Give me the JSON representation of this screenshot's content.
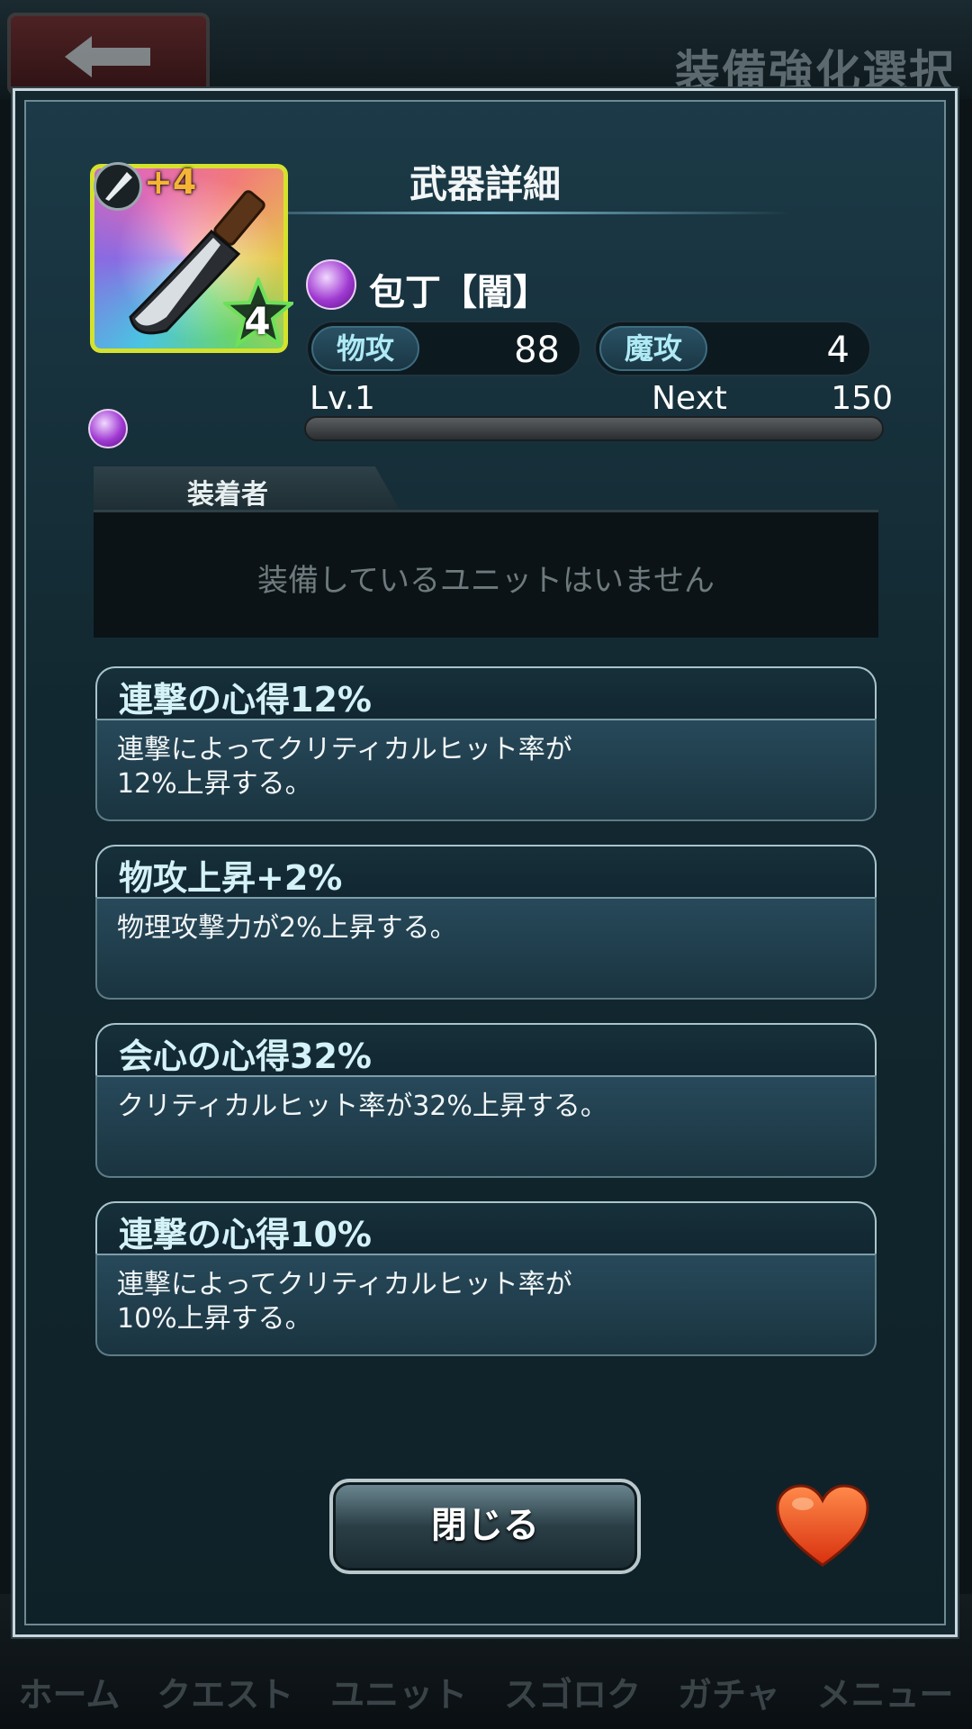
{
  "background": {
    "screen_title": "装備強化選択",
    "nav_items": [
      "ホーム",
      "クエスト",
      "ユニット",
      "スゴロク",
      "ガチャ",
      "メニュー"
    ]
  },
  "modal": {
    "title": "武器詳細",
    "weapon": {
      "name": "包丁【闇】",
      "plus": "+4",
      "rarity": "4",
      "element_icon": "dark-element-icon",
      "type_icon": "knife-type-icon",
      "stats": {
        "phys_label": "物攻",
        "phys_value": "88",
        "mag_label": "魔攻",
        "mag_value": "4"
      },
      "level": "Lv.1",
      "next_label": "Next",
      "next_value": "150",
      "exp_progress": 0.0
    },
    "equipped": {
      "tab_label": "装着者",
      "empty_text": "装備しているユニットはいません"
    },
    "skills": [
      {
        "name": "連撃の心得12%",
        "desc": "連撃によってクリティカルヒット率が\n12%上昇する。"
      },
      {
        "name": "物攻上昇+2%",
        "desc": "物理攻撃力が2%上昇する。"
      },
      {
        "name": "会心の心得32%",
        "desc": "クリティカルヒット率が32%上昇する。"
      },
      {
        "name": "連撃の心得10%",
        "desc": "連撃によってクリティカルヒット率が\n10%上昇する。"
      }
    ],
    "close_label": "閉じる",
    "favorite_icon": "heart-icon"
  }
}
